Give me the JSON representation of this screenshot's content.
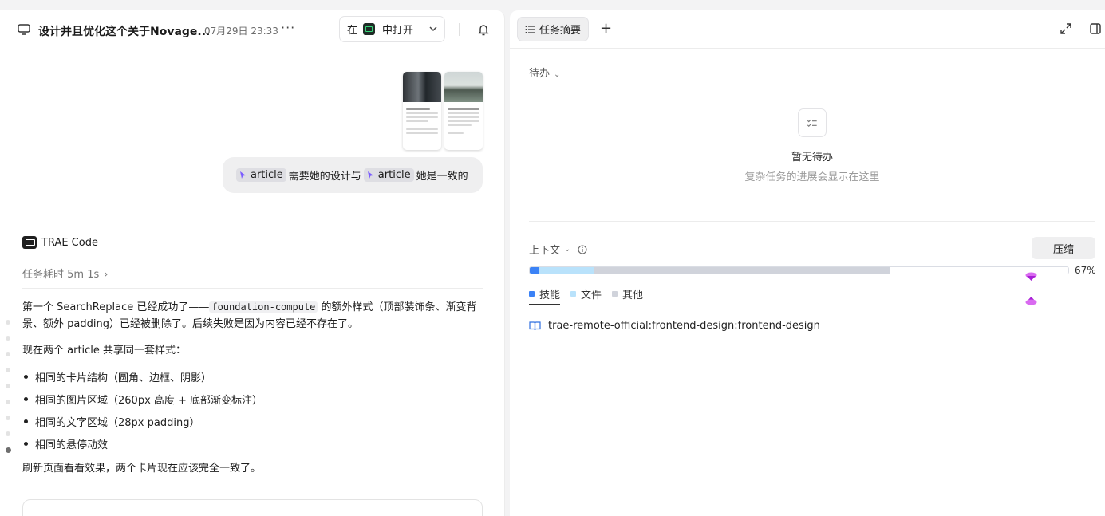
{
  "left": {
    "title": "设计并且优化这个关于Novage...",
    "timestamp": "07月29日 23:33",
    "more_label": "···",
    "open_in": {
      "prefix": "在",
      "suffix": "中打开"
    },
    "user_message": {
      "chip1": "article",
      "text1": "需要她的设计与",
      "chip2": "article",
      "text2": "她是一致的"
    },
    "agent": {
      "name": "TRAE Code",
      "elapsed": "任务耗时 5m 1s"
    },
    "reply": {
      "para1_a": "第一个 SearchReplace 已经成功了——",
      "para1_code": "foundation-compute",
      "para1_b": "的额外样式（顶部装饰条、渐变背景、额外 padding）已经被删除了。后续失败是因为内容已经不存在了。",
      "para2": "现在两个 article 共享同一套样式：",
      "bullets": [
        "相同的卡片结构（圆角、边框、阴影）",
        "相同的图片区域（260px 高度 + 底部渐变标注）",
        "相同的文字区域（28px padding）",
        "相同的悬停动效"
      ],
      "para3": "刷新页面看看效果，两个卡片现在应该完全一致了。"
    }
  },
  "right": {
    "tab_label": "任务摘要",
    "add_label": "+",
    "todo": {
      "label": "待办",
      "empty_title": "暂无待办",
      "empty_sub": "复杂任务的进展会显示在这里"
    },
    "context": {
      "label": "上下文",
      "compress_label": "压缩",
      "percent": "67%",
      "usage": {
        "skills": 0.016,
        "files": 0.104,
        "other": 0.55
      },
      "colors": {
        "skills": "#3b82f6",
        "files": "#b9e2fb",
        "other": "#d0d3db"
      },
      "legend": {
        "skills": "技能",
        "files": "文件",
        "other": "其他"
      },
      "skill_item": "trae-remote-official:frontend-design:frontend-design"
    }
  }
}
